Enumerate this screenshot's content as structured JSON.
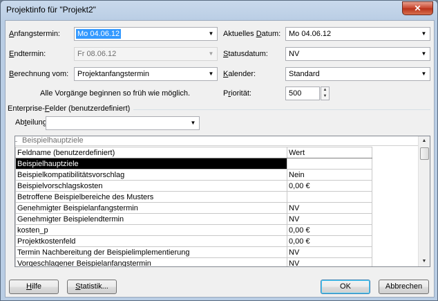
{
  "window": {
    "title": "Projektinfo für \"Projekt2\"",
    "close_glyph": "✕"
  },
  "fields": {
    "start": {
      "label_u": "A",
      "label_rest": "nfangstermin:",
      "value": "Mo 04.06.12"
    },
    "end": {
      "label_u": "E",
      "label_rest": "ndtermin:",
      "value": "Fr 08.06.12"
    },
    "calc_from": {
      "label_u": "B",
      "label_rest": "erechnung vom:",
      "value": "Projektanfangstermin"
    },
    "note": "Alle Vorgänge beginnen so früh wie möglich.",
    "current_date": {
      "label_pre": "Aktuelles ",
      "label_u": "D",
      "label_rest": "atum:",
      "value": "Mo 04.06.12"
    },
    "status_date": {
      "label_u": "S",
      "label_rest": "tatusdatum:",
      "value": "NV"
    },
    "calendar": {
      "label_u": "K",
      "label_rest": "alender:",
      "value": "Standard"
    },
    "priority": {
      "label_pre": "P",
      "label_u": "r",
      "label_rest": "iorität:",
      "value": "500"
    }
  },
  "enterprise": {
    "section_pre": "Enterprise-",
    "section_u": "F",
    "section_rest": "elder (benutzerdefiniert)",
    "dept_pre": "Ab",
    "dept_u": "t",
    "dept_rest": "eilung:",
    "dept_value": ""
  },
  "grid": {
    "group_label": "Beispielhauptziele",
    "col_field": "Feldname (benutzerdefiniert)",
    "col_value": "Wert",
    "rows": [
      {
        "name": "Beispielhauptziele",
        "value": ""
      },
      {
        "name": "Beispielkompatibilitätsvorschlag",
        "value": "Nein"
      },
      {
        "name": "Beispielvorschlagskosten",
        "value": "0,00 €"
      },
      {
        "name": "Betroffene Beispielbereiche des Musters",
        "value": ""
      },
      {
        "name": "Genehmigter Beispielanfangstermin",
        "value": "NV"
      },
      {
        "name": "Genehmigter Beispielendtermin",
        "value": "NV"
      },
      {
        "name": "kosten_p",
        "value": "0,00 €"
      },
      {
        "name": "Projektkostenfeld",
        "value": "0,00 €"
      },
      {
        "name": "Termin Nachbereitung der Beispielimplementierung",
        "value": "NV"
      },
      {
        "name": "Vorgeschlagener Beispielanfangstermin",
        "value": "NV"
      }
    ]
  },
  "buttons": {
    "help": "Hilfe",
    "stats": "Statistik...",
    "ok": "OK",
    "cancel": "Abbrechen"
  },
  "colors": {
    "title_bg": "#b9cde4",
    "client_bg": "#f0f0f0",
    "selection": "#3399ff",
    "close": "#c7432b"
  }
}
